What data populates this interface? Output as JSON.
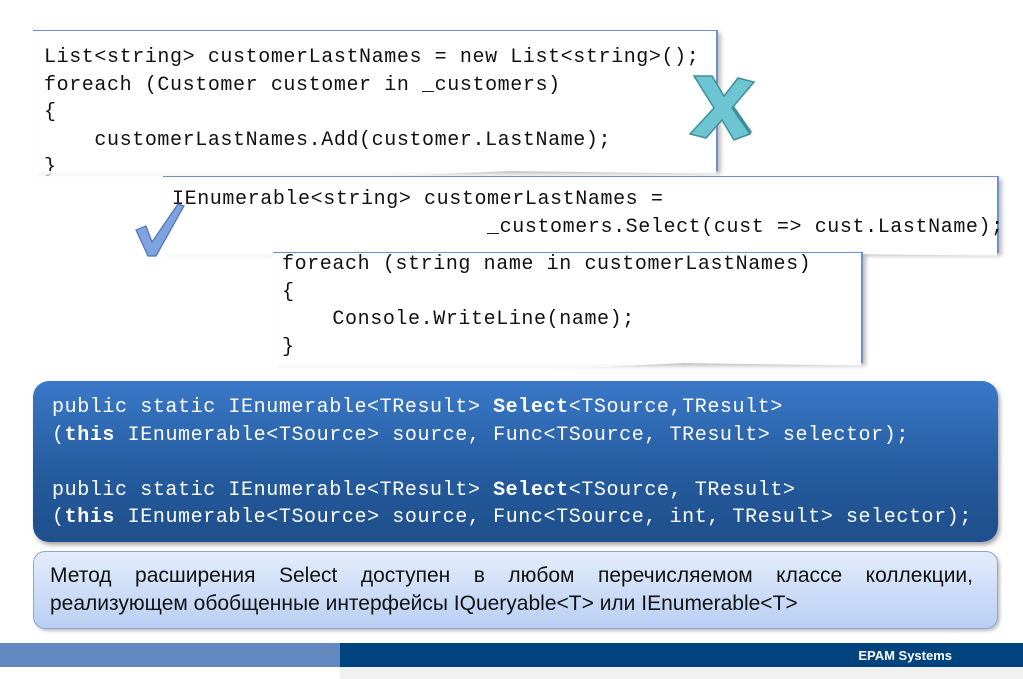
{
  "code_old": {
    "lines": [
      "List<string> customerLastNames = new List<string>();",
      "foreach (Customer customer in _customers)",
      "{",
      "    customerLastNames.Add(customer.LastName);",
      "}"
    ]
  },
  "code_new": {
    "lines": [
      "IEnumerable<string> customerLastNames =",
      "                         _customers.Select(cust => cust.LastName);"
    ]
  },
  "code_loop": {
    "lines": [
      "foreach (string name in customerLastNames)",
      "{",
      "    Console.WriteLine(name);",
      "}"
    ]
  },
  "icons": {
    "wrong": "x-mark-icon",
    "right": "check-mark-icon",
    "wrong_color": "#6cc5d0",
    "right_color": "#7fa3e0"
  },
  "signatures": [
    {
      "l1_pre": "public static IEnumerable<TResult> ",
      "l1_bold": "Select",
      "l1_post": "<TSource,TResult>",
      "l2_pre": "(",
      "l2_bold": "this",
      "l2_post": " IEnumerable<TSource> source, Func<TSource, TResult> selector);"
    },
    {
      "l1_pre": "public static IEnumerable<TResult> ",
      "l1_bold": "Select",
      "l1_post": "<TSource, TResult>",
      "l2_pre": "(",
      "l2_bold": "this",
      "l2_post": " IEnumerable<TSource> source, Func<TSource, int, TResult> selector);"
    }
  ],
  "note": {
    "line1": "Метод расширения Select доступен в любом перечисляемом классе коллекции,",
    "line2": "реализующем обобщенные интерфейсы IQueryable<T> или IEnumerable<T>"
  },
  "footer": {
    "company": "EPAM Systems"
  }
}
